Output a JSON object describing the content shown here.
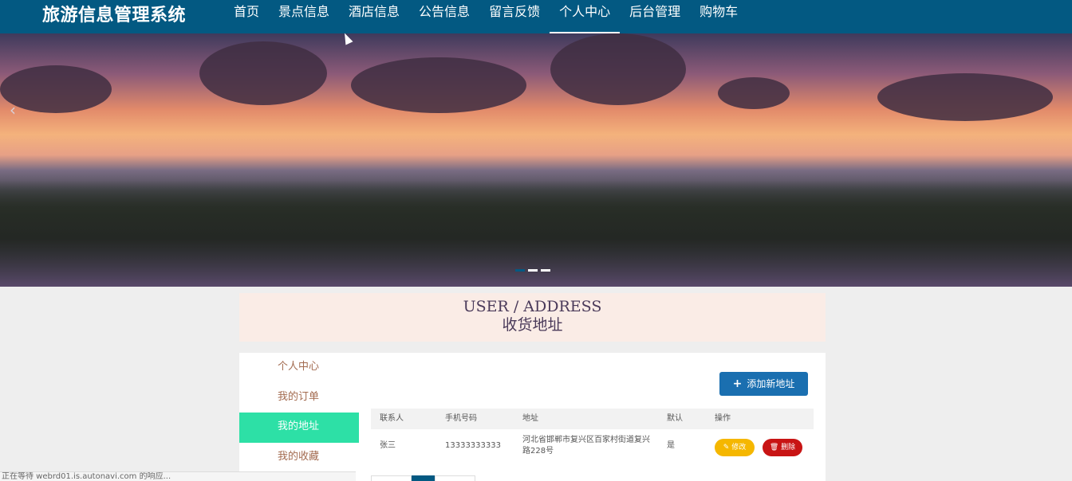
{
  "app": {
    "title": "旅游信息管理系统"
  },
  "nav": {
    "items": [
      {
        "label": "首页",
        "active": false
      },
      {
        "label": "景点信息",
        "active": false
      },
      {
        "label": "酒店信息",
        "active": false
      },
      {
        "label": "公告信息",
        "active": false
      },
      {
        "label": "留言反馈",
        "active": false
      },
      {
        "label": "个人中心",
        "active": true
      },
      {
        "label": "后台管理",
        "active": false
      },
      {
        "label": "购物车",
        "active": false
      }
    ]
  },
  "banner": {
    "prev_glyph": "‹",
    "active_dot": 0,
    "dot_count": 3
  },
  "section": {
    "title_en": "USER / ADDRESS",
    "title_zh": "收货地址"
  },
  "sidebar": {
    "items": [
      {
        "label": "个人中心",
        "active": false
      },
      {
        "label": "我的订单",
        "active": false
      },
      {
        "label": "我的地址",
        "active": true
      },
      {
        "label": "我的收藏",
        "active": false
      }
    ]
  },
  "toolbar": {
    "add_label": "添加新地址",
    "add_icon": "plus-icon"
  },
  "table": {
    "headers": [
      "联系人",
      "手机号码",
      "地址",
      "默认",
      "操作"
    ],
    "rows": [
      {
        "contact": "张三",
        "phone": "13333333333",
        "address": "河北省邯郸市复兴区百家村街道复兴路228号",
        "default": "是",
        "edit_label": "修改",
        "delete_label": "删除"
      }
    ]
  },
  "status_bar": {
    "text": "正在等待 webrd01.is.autonavi.com 的响应..."
  },
  "colors": {
    "nav_bg": "#035982",
    "accent_green": "#2de0a6",
    "add_button": "#1a6fb0",
    "edit_button": "#f5b700",
    "delete_button": "#c81414"
  }
}
